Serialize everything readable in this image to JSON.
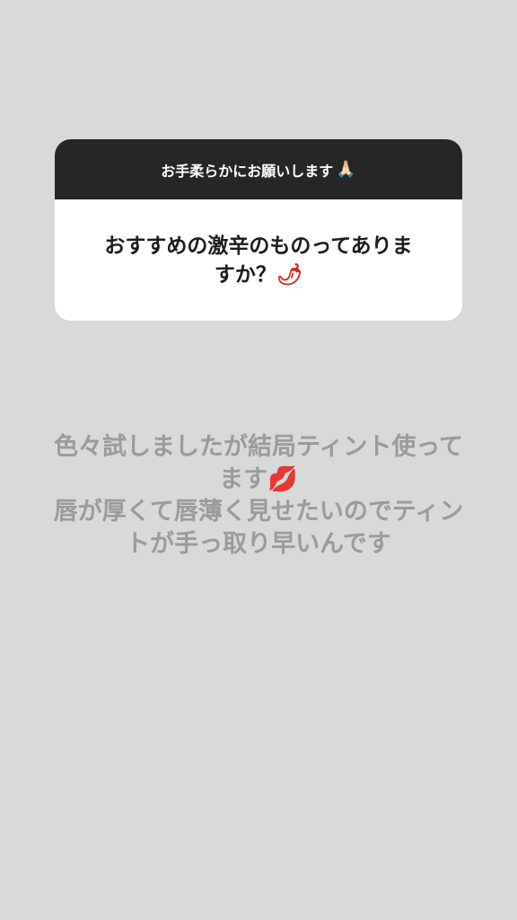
{
  "question_sticker": {
    "prompt": "お手柔らかにお願いします",
    "prompt_emoji": "🙏🏻",
    "question_line1": "おすすめの激辛のものってありま",
    "question_line2": "すか？",
    "question_emoji": "🌶"
  },
  "answer": {
    "line1": "色々試しましたが結局ティント使って",
    "line2": "ます",
    "line2_emoji": "💋",
    "line3": "唇が厚くて唇薄く見せたいのでティン",
    "line4": "トが手っ取り早いんです"
  }
}
